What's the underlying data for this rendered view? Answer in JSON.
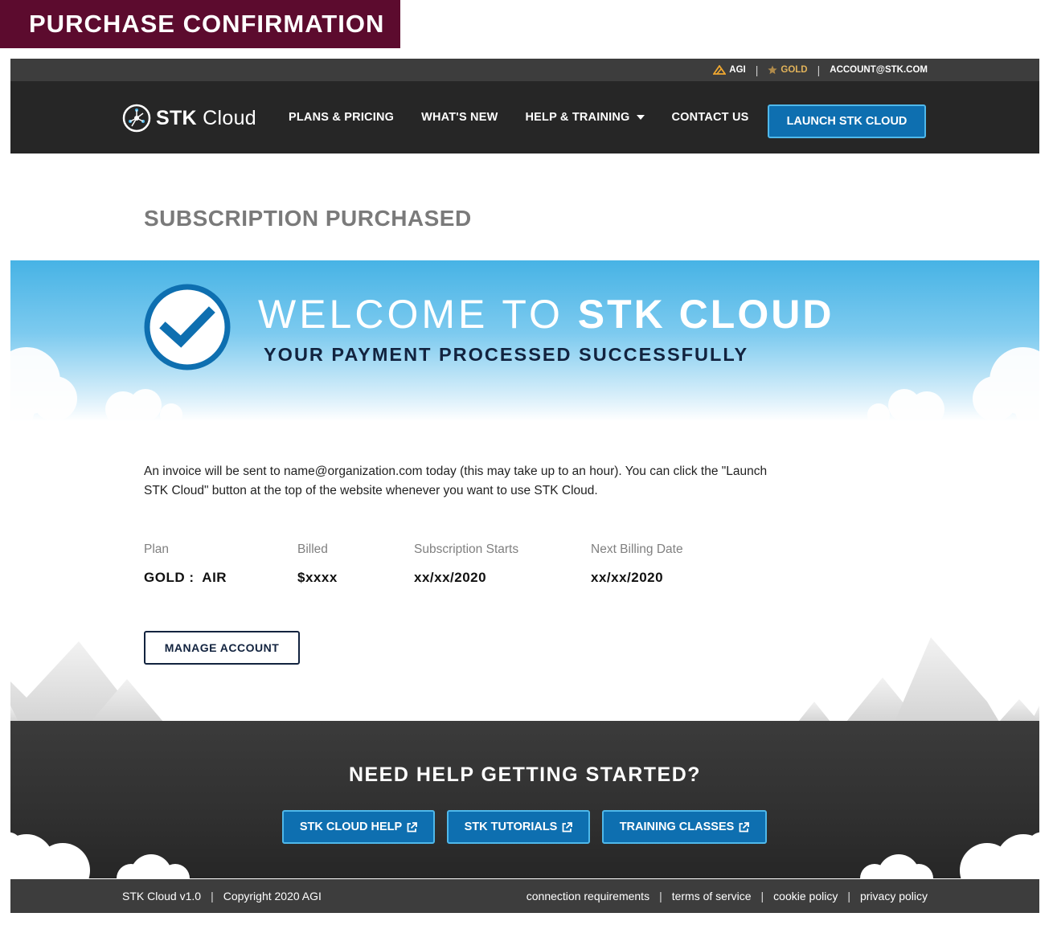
{
  "frame_label": "PURCHASE CONFIRMATION",
  "utility_bar": {
    "agi": "AGI",
    "tier": "GOLD",
    "account": "ACCOUNT@STK.COM"
  },
  "nav": {
    "logo_bold": "STK",
    "logo_light": "Cloud",
    "links": [
      "PLANS & PRICING",
      "WHAT'S NEW",
      "HELP & TRAINING",
      "CONTACT US"
    ],
    "launch": "LAUNCH STK CLOUD"
  },
  "page_title": "SUBSCRIPTION PURCHASED",
  "hero": {
    "welcome_light": "WELCOME TO",
    "welcome_bold": "STK CLOUD",
    "subtitle": "YOUR PAYMENT PROCESSED SUCCESSFULLY"
  },
  "invoice_text": "An invoice will be sent to name@organization.com today (this may take up to an hour). You can click the \"Launch STK Cloud\" button at the top of the website whenever you want to use STK Cloud.",
  "details": {
    "plan_label": "Plan",
    "plan_value": "GOLD :  AIR",
    "billed_label": "Billed",
    "billed_value": "$xxxx",
    "starts_label": "Subscription Starts",
    "starts_value": "xx/xx/2020",
    "next_label": "Next Billing Date",
    "next_value": "xx/xx/2020"
  },
  "manage_button": "MANAGE ACCOUNT",
  "help": {
    "title": "NEED HELP GETTING STARTED?",
    "buttons": [
      "STK CLOUD HELP",
      "STK TUTORIALS",
      "TRAINING CLASSES"
    ]
  },
  "footer": {
    "version": "STK Cloud v1.0",
    "copyright": "Copyright 2020 AGI",
    "links": [
      "connection requirements",
      "terms of service",
      "cookie policy",
      "privacy policy"
    ]
  },
  "colors": {
    "accent_blue": "#0e6fb0",
    "nav_dark": "#262626",
    "frame_label_bg": "#5c0b2e",
    "gold": "#e0b25a",
    "navy": "#12233f"
  }
}
